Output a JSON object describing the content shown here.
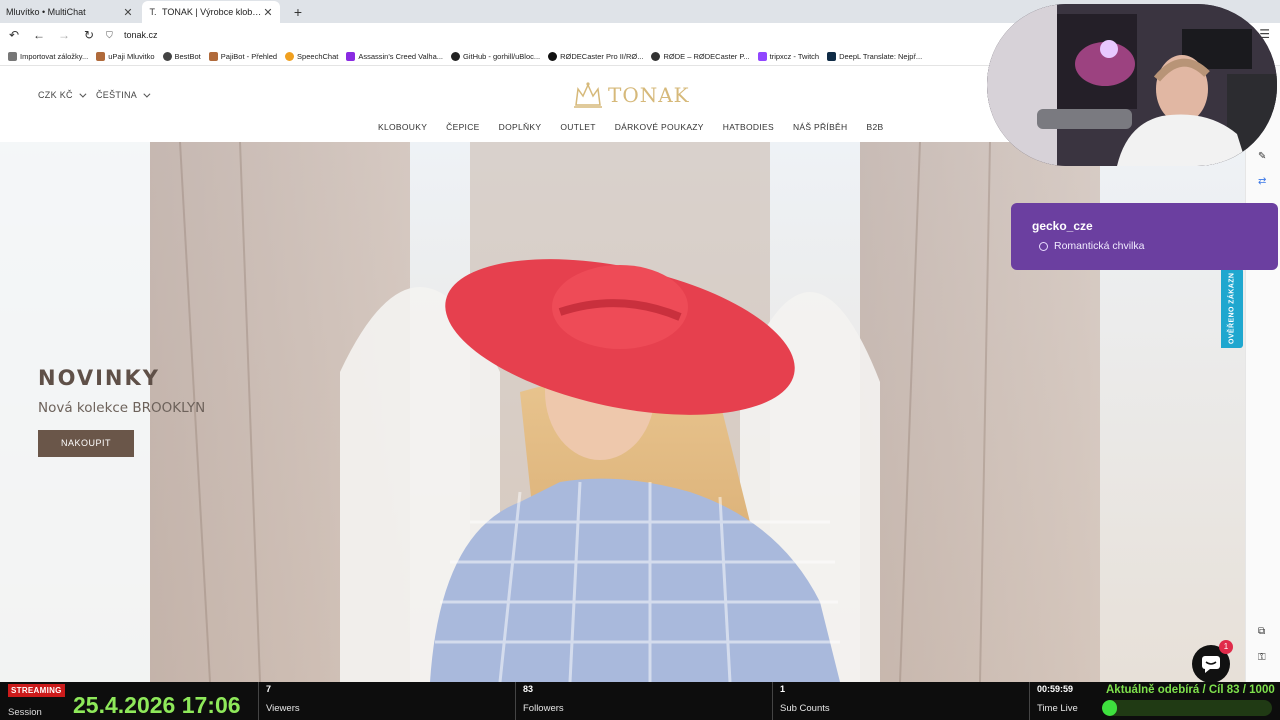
{
  "browser": {
    "tabs": [
      {
        "title": "Mluvítko • MultiChat",
        "active": false
      },
      {
        "title": "TONAK | Výrobce klobouků od",
        "active": true
      }
    ],
    "url": "tonak.cz",
    "bookmarks": [
      {
        "label": "Importovat záložky...",
        "color": "#777777"
      },
      {
        "label": "uPaji Mluvitko",
        "color": "#b06a3b"
      },
      {
        "label": "BestBot",
        "color": "#444444"
      },
      {
        "label": "PajiBot - Přehled",
        "color": "#b06a3b"
      },
      {
        "label": "SpeechChat",
        "color": "#f0a020"
      },
      {
        "label": "Assassin's Creed Valha...",
        "color": "#8a2be2"
      },
      {
        "label": "GitHub - gorhill/uBloc...",
        "color": "#222222"
      },
      {
        "label": "RØDECaster Pro II/RØ...",
        "color": "#111111"
      },
      {
        "label": "RØDE – RØDECaster P...",
        "color": "#333333"
      },
      {
        "label": "tripxcz - Twitch",
        "color": "#9146ff"
      },
      {
        "label": "DeepL Translate: Nejpř...",
        "color": "#0f2b46"
      }
    ]
  },
  "site": {
    "currency": "CZK KČ",
    "language": "ČEŠTINA",
    "logo_text": "TONAK",
    "nav": [
      "KLOBOUKY",
      "ČEPICE",
      "DOPLŇKY",
      "OUTLET",
      "DÁRKOVÉ POUKAZY",
      "HATBODIES",
      "NÁŠ PŘÍBĚH",
      "B2B"
    ],
    "hero": {
      "title": "NOVINKY",
      "subtitle": "Nová kolekce BROOKLYN",
      "button": "NAKOUPIT"
    },
    "verified_badge": "OVĚŘENO ZÁKAZN",
    "chat_badge_count": "1"
  },
  "overlay": {
    "chat": {
      "user": "gecko_cze",
      "message": "Romantická chvilka"
    },
    "stream": {
      "status": "STREAMING",
      "session_label": "Session",
      "datetime": "25.4.2026 17:06",
      "stats": [
        {
          "value": "7",
          "label": "Viewers"
        },
        {
          "value": "83",
          "label": "Followers"
        },
        {
          "value": "1",
          "label": "Sub Counts"
        },
        {
          "value": "00:59:59",
          "label": "Time Live"
        }
      ],
      "goal_text": "Aktuálně odebírá / Cíl 83 / 1000",
      "goal_progress": 0.083
    }
  }
}
